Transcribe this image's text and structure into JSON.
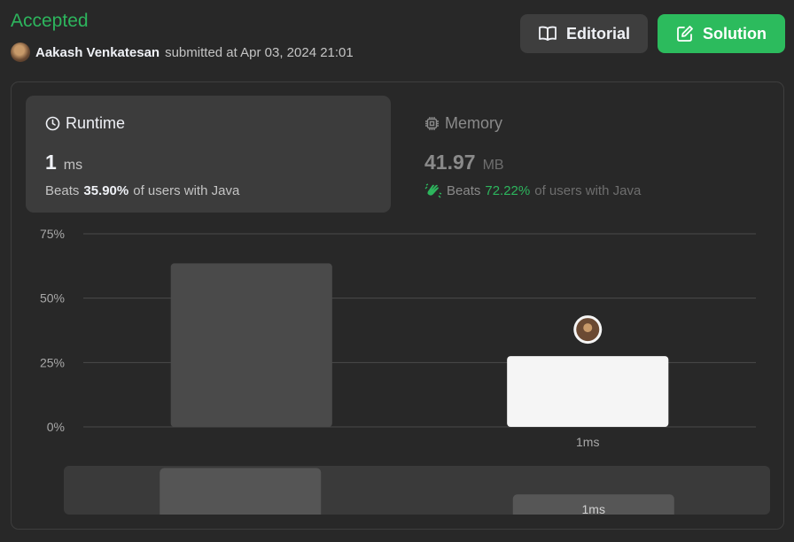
{
  "header": {
    "status": "Accepted",
    "user": "Aakash Venkatesan",
    "submitted_text": "submitted at Apr 03, 2024 21:01",
    "editorial_label": "Editorial",
    "solution_label": "Solution"
  },
  "runtime": {
    "title": "Runtime",
    "value": "1",
    "unit": "ms",
    "beats_prefix": "Beats",
    "beats_pct": "35.90%",
    "beats_suffix": "of users with Java"
  },
  "memory": {
    "title": "Memory",
    "value": "41.97",
    "unit": "MB",
    "beats_prefix": "Beats",
    "beats_pct": "72.22%",
    "beats_suffix": "of users with Java"
  },
  "colors": {
    "accepted": "#2db55d",
    "solution_button": "#2cbb5d",
    "bar_other": "#4a4a4a",
    "bar_user": "#f5f5f5"
  },
  "chart_data": {
    "type": "bar",
    "y_ticks": [
      "75%",
      "50%",
      "25%",
      "0%"
    ],
    "ylim": [
      0,
      75
    ],
    "grid": true,
    "bars": [
      {
        "category": "",
        "value": 63.5,
        "highlight": false
      },
      {
        "category": "1ms",
        "value": 27.5,
        "highlight": true
      }
    ],
    "mini_bars": [
      {
        "category": "",
        "value": 63.5,
        "highlight": false
      },
      {
        "category": "1ms",
        "value": 27.5,
        "highlight": true
      }
    ]
  }
}
